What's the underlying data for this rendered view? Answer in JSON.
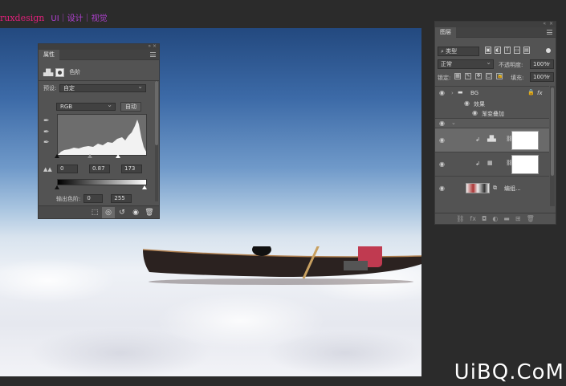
{
  "watermark": {
    "left": "ruxdesign",
    "sub": "UI｜设计｜视觉"
  },
  "properties": {
    "tab": "属性",
    "title": "色阶",
    "preset_label": "预设:",
    "preset_value": "自定",
    "channel": "RGB",
    "auto_button": "自动",
    "input_black": "0",
    "input_gamma": "0.87",
    "input_white": "173",
    "output_label": "输出色阶:",
    "output_black": "0",
    "output_white": "255"
  },
  "layers": {
    "tab": "图层",
    "filter_kind": "类型",
    "blend_mode": "正常",
    "opacity_label": "不透明度:",
    "opacity_value": "100%",
    "lock_label": "锁定:",
    "fill_label": "填充:",
    "fill_value": "100%",
    "group_name": "BG",
    "effects_label": "效果",
    "effect_name": "渐变叠加",
    "layer3_name": "编组..."
  },
  "brand": "UiBQ.CoM"
}
